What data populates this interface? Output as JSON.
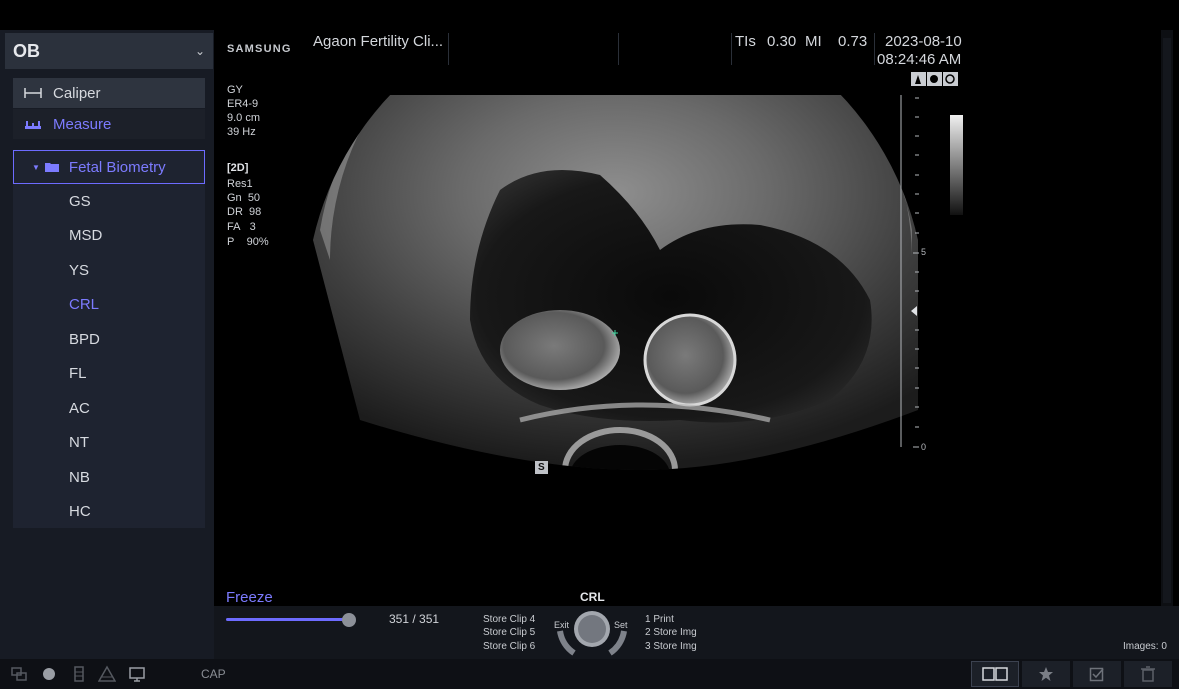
{
  "preset": {
    "label": "OB"
  },
  "tools": {
    "caliper": "Caliper",
    "measure": "Measure"
  },
  "measurement_package": {
    "label": "Fetal Biometry",
    "items": [
      "GS",
      "MSD",
      "YS",
      "CRL",
      "BPD",
      "FL",
      "AC",
      "NT",
      "NB",
      "HC"
    ],
    "active": "CRL"
  },
  "header": {
    "brand": "SAMSUNG",
    "hospital": "Agaon Fertility Cli...",
    "tis_label": "TIs",
    "tis_value": "0.30",
    "mi_label": "MI",
    "mi_value": "0.73",
    "date": "2023-08-10",
    "time": "08:24:46 AM"
  },
  "probe": {
    "app": "GY",
    "name": "ER4-9",
    "depth": "9.0 cm",
    "frame_rate": "39 Hz"
  },
  "image_params": {
    "mode": "[2D]",
    "res": "Res1",
    "lines": [
      {
        "k": "Gn",
        "v": "50"
      },
      {
        "k": "DR",
        "v": "98"
      },
      {
        "k": "FA",
        "v": "3"
      },
      {
        "k": "P",
        "v": "90%"
      }
    ]
  },
  "depth_scale": {
    "mid_label": "5",
    "bottom_label": "0"
  },
  "image_marker": "S",
  "cine": {
    "freeze_label": "Freeze",
    "count": "351 / 351",
    "position": 1.0
  },
  "store_clips": [
    "Store Clip  4",
    "Store Clip  5",
    "Store Clip  6"
  ],
  "knob": {
    "title": "CRL",
    "exit": "Exit",
    "set": "Set"
  },
  "print_options": [
    "1  Print",
    "2  Store Img",
    "3  Store Img"
  ],
  "images_count": "Images: 0",
  "status": {
    "cap": "CAP"
  },
  "colors": {
    "accent": "#7c7bff",
    "sidebar_bg": "#171b24"
  },
  "icons": {
    "caliper": "caliper-icon",
    "measure": "measure-icon",
    "folder": "folder-icon",
    "layout": "dual-layout-icon",
    "star": "star-icon",
    "check": "checkbox-icon",
    "trash": "trash-icon"
  }
}
